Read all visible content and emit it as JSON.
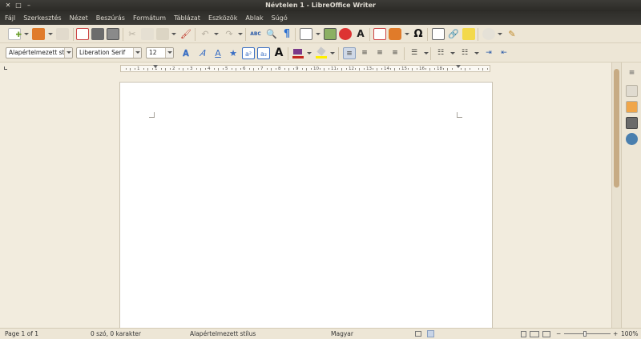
{
  "window": {
    "title": "Névtelen 1 - LibreOffice Writer"
  },
  "menu": [
    "Fájl",
    "Szerkesztés",
    "Nézet",
    "Beszúrás",
    "Formátum",
    "Táblázat",
    "Eszközök",
    "Ablak",
    "Súgó"
  ],
  "format_toolbar": {
    "paragraph_style": "Alapértelmezett st",
    "font_name": "Liberation Serif",
    "font_size": "12"
  },
  "standard_toolbar": {
    "special_char_glyph": "Ω",
    "fontwork_glyph": "A"
  },
  "ruler": {
    "labels": [
      "1",
      "1",
      "2",
      "3",
      "4",
      "5",
      "6",
      "7",
      "8",
      "9",
      "10",
      "11",
      "12",
      "13",
      "14",
      "15",
      "16",
      "18"
    ]
  },
  "status": {
    "page": "Page 1 of 1",
    "words": "0 szó, 0 karakter",
    "style": "Alapértelmezett stílus",
    "language": "Magyar",
    "zoom": "100%",
    "zoom_minus": "−",
    "zoom_plus": "+"
  },
  "colors": {
    "titlebar": "#3c3b37",
    "toolbar_bg": "#ede6d6",
    "workspace_bg": "#f2ecde",
    "scroll_thumb": "#c7ab84",
    "font_color_bar": "#c2281e",
    "highlight_bar": "#ffef00"
  }
}
